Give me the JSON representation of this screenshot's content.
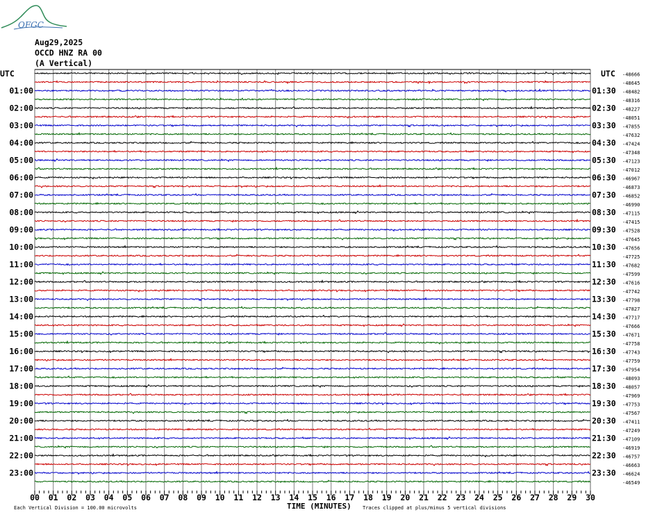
{
  "header": {
    "logo_text": "OFGC",
    "date": "Aug29,2025",
    "station": "OCCD HNZ RA 00",
    "component": "(A Vertical)"
  },
  "footer": {
    "division_note": "Each Vertical Division =  100.00 microvolts",
    "axis_title": "TIME (MINUTES)",
    "clip_note": "Traces clipped at plus/minus 5 vertical divisions"
  },
  "colors": {
    "trace_cycle": [
      "#000000",
      "#cc0000",
      "#0000cc",
      "#006600"
    ],
    "grid": "#808080"
  },
  "chart_data": {
    "type": "line",
    "title": "",
    "xlabel": "TIME (MINUTES)",
    "xlim": [
      0,
      30
    ],
    "x_ticks": [
      "00",
      "01",
      "02",
      "03",
      "04",
      "05",
      "06",
      "07",
      "08",
      "09",
      "10",
      "11",
      "12",
      "13",
      "14",
      "15",
      "16",
      "17",
      "18",
      "19",
      "20",
      "21",
      "22",
      "23",
      "24",
      "25",
      "26",
      "27",
      "28",
      "29",
      "30"
    ],
    "left_axis_title": "UTC",
    "right_axis_title": "UTC",
    "left_hour_labels": [
      "01:00",
      "02:00",
      "03:00",
      "04:00",
      "05:00",
      "06:00",
      "07:00",
      "08:00",
      "09:00",
      "10:00",
      "11:00",
      "12:00",
      "13:00",
      "14:00",
      "15:00",
      "16:00",
      "17:00",
      "18:00",
      "19:00",
      "20:00",
      "21:00",
      "22:00",
      "23:00"
    ],
    "right_half_hour_labels": [
      "01:30",
      "02:30",
      "03:30",
      "04:30",
      "05:30",
      "06:30",
      "07:30",
      "08:30",
      "09:30",
      "10:30",
      "11:30",
      "12:30",
      "13:30",
      "14:30",
      "15:30",
      "16:30",
      "17:30",
      "18:30",
      "19:30",
      "20:30",
      "21:30",
      "22:30",
      "23:30"
    ],
    "trace_offsets": [
      -48666,
      -48645,
      -48482,
      -48316,
      -48227,
      -48051,
      -47855,
      -47632,
      -47424,
      -47348,
      -47123,
      -47012,
      -46967,
      -46873,
      -46852,
      -46990,
      -47115,
      -47415,
      -47528,
      -47645,
      -47656,
      -47725,
      -47682,
      -47599,
      -47616,
      -47742,
      -47798,
      -47827,
      -47717,
      -47666,
      -47671,
      -47758,
      -47743,
      -47759,
      -47954,
      -48093,
      -48057,
      -47969,
      -47753,
      -47567,
      -47411,
      -47249,
      -47109,
      -46919,
      -46757,
      -46663,
      -46624,
      -46549
    ],
    "grid": true
  }
}
